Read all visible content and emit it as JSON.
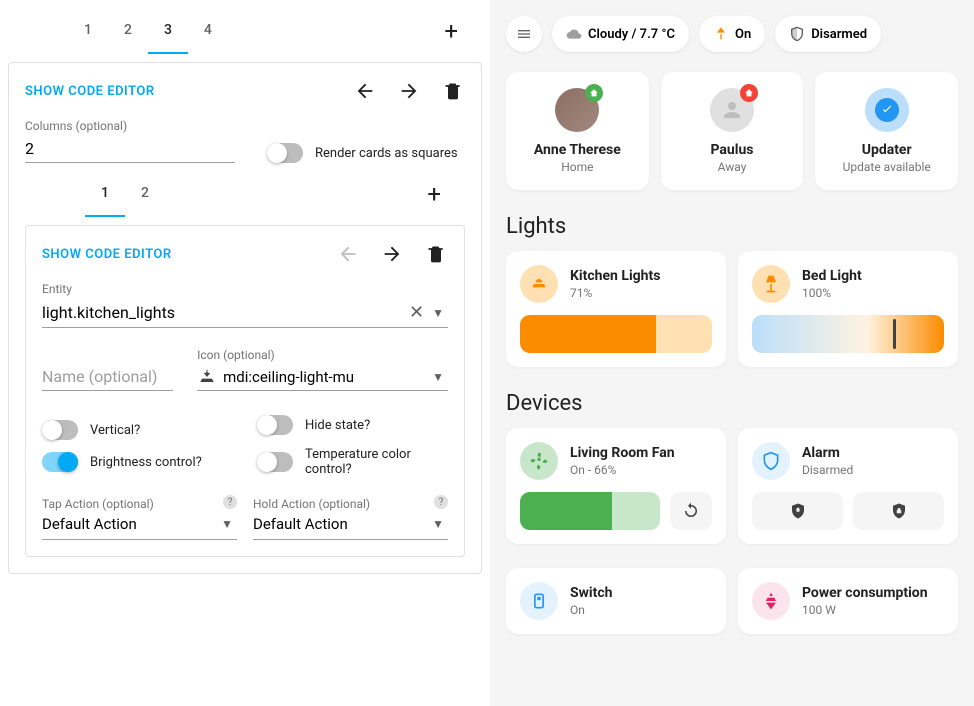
{
  "editor": {
    "outerTabs": [
      "1",
      "2",
      "3",
      "4"
    ],
    "outerActiveTab": "3",
    "showCodeEditor": "SHOW CODE EDITOR",
    "columnsLabel": "Columns (optional)",
    "columnsValue": "2",
    "renderSquaresLabel": "Render cards as squares",
    "innerTabs": [
      "1",
      "2"
    ],
    "innerActiveTab": "1",
    "entityLabel": "Entity",
    "entityValue": "light.kitchen_lights",
    "nameLabel": "Name (optional)",
    "nameValue": "",
    "iconLabel": "Icon (optional)",
    "iconValue": "mdi:ceiling-light-mu",
    "verticalLabel": "Vertical?",
    "hideStateLabel": "Hide state?",
    "brightnessLabel": "Brightness control?",
    "tempColorLabel": "Temperature color control?",
    "tapActionLabel": "Tap Action (optional)",
    "tapActionValue": "Default Action",
    "holdActionLabel": "Hold Action (optional)",
    "holdActionValue": "Default Action"
  },
  "dashboard": {
    "weather": "Cloudy / 7.7 °C",
    "lightChip": "On",
    "alarmChip": "Disarmed",
    "people": [
      {
        "name": "Anne Therese",
        "status": "Home",
        "badge": "green"
      },
      {
        "name": "Paulus",
        "status": "Away",
        "badge": "red"
      },
      {
        "name": "Updater",
        "status": "Update available",
        "badge": "blue"
      }
    ],
    "lightsTitle": "Lights",
    "lights": [
      {
        "name": "Kitchen Lights",
        "status": "71%",
        "fill": 71
      },
      {
        "name": "Bed Light",
        "status": "100%",
        "fill": 100
      }
    ],
    "devicesTitle": "Devices",
    "devices": {
      "fan": {
        "name": "Living Room Fan",
        "status": "On - 66%",
        "fill": 66
      },
      "alarm": {
        "name": "Alarm",
        "status": "Disarmed"
      },
      "switch": {
        "name": "Switch",
        "status": "On"
      },
      "power": {
        "name": "Power consumption",
        "status": "100 W"
      }
    }
  }
}
